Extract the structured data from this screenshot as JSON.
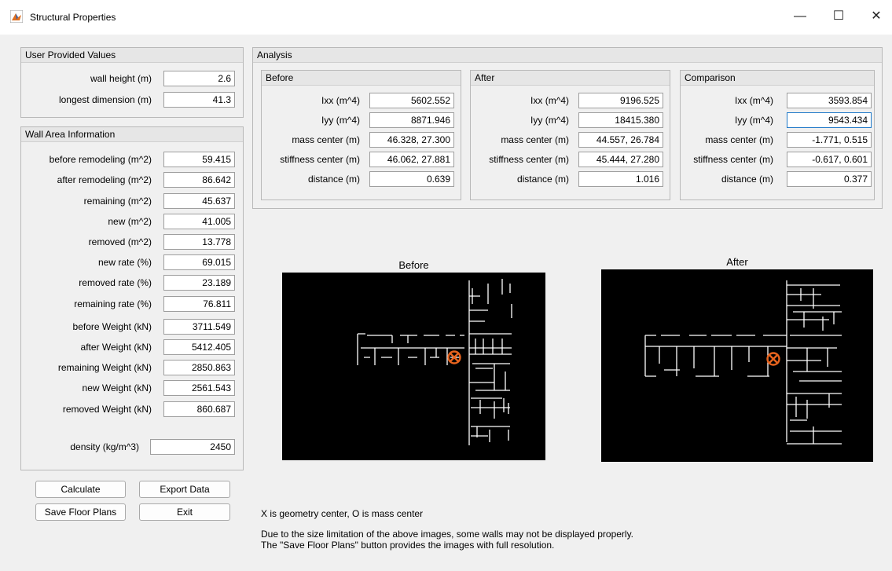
{
  "window": {
    "title": "Structural Properties",
    "minimize": "—",
    "maximize": "☐",
    "close": "✕"
  },
  "user_values": {
    "title": "User Provided Values",
    "rows": [
      {
        "label": "wall height (m)",
        "value": "2.6"
      },
      {
        "label": "longest dimension (m)",
        "value": "41.3"
      }
    ]
  },
  "wall_area": {
    "title": "Wall Area Information",
    "rows": [
      {
        "label": "before remodeling (m^2)",
        "value": "59.415"
      },
      {
        "label": "after remodeling (m^2)",
        "value": "86.642"
      },
      {
        "label": "remaining (m^2)",
        "value": "45.637"
      },
      {
        "label": "new (m^2)",
        "value": "41.005"
      },
      {
        "label": "removed (m^2)",
        "value": "13.778"
      },
      {
        "label": "new rate (%)",
        "value": "69.015"
      },
      {
        "label": "removed rate (%)",
        "value": "23.189"
      },
      {
        "label": "remaining rate (%)",
        "value": "76.811"
      },
      {
        "label": "before Weight (kN)",
        "value": "3711.549"
      },
      {
        "label": "after Weight (kN)",
        "value": "5412.405"
      },
      {
        "label": "remaining Weight (kN)",
        "value": "2850.863"
      },
      {
        "label": "new Weight (kN)",
        "value": "2561.543"
      },
      {
        "label": "removed Weight (kN)",
        "value": "860.687"
      }
    ],
    "density_label": "density (kg/m^3)",
    "density_value": "2450"
  },
  "buttons": {
    "calculate": "Calculate",
    "export": "Export Data",
    "save_plans": "Save Floor Plans",
    "exit": "Exit"
  },
  "analysis": {
    "title": "Analysis",
    "groups": [
      {
        "title": "Before",
        "rows": [
          {
            "label": "Ixx (m^4)",
            "value": "5602.552"
          },
          {
            "label": "Iyy (m^4)",
            "value": "8871.946"
          },
          {
            "label": "mass center (m)",
            "value": "46.328, 27.300"
          },
          {
            "label": "stiffness center (m)",
            "value": "46.062, 27.881"
          },
          {
            "label": "distance (m)",
            "value": "0.639"
          }
        ]
      },
      {
        "title": "After",
        "rows": [
          {
            "label": "Ixx (m^4)",
            "value": "9196.525"
          },
          {
            "label": "Iyy (m^4)",
            "value": "18415.380"
          },
          {
            "label": "mass center (m)",
            "value": "44.557, 26.784"
          },
          {
            "label": "stiffness center (m)",
            "value": "45.444, 27.280"
          },
          {
            "label": "distance (m)",
            "value": "1.016"
          }
        ]
      },
      {
        "title": "Comparison",
        "rows": [
          {
            "label": "Ixx (m^4)",
            "value": "3593.854"
          },
          {
            "label": "Iyy (m^4)",
            "value": "9543.434"
          },
          {
            "label": "mass center (m)",
            "value": "-1.771, 0.515"
          },
          {
            "label": "stiffness center (m)",
            "value": "-0.617, 0.601"
          },
          {
            "label": "distance (m)",
            "value": "0.377"
          }
        ]
      }
    ]
  },
  "plots": {
    "before_title": "Before",
    "after_title": "After",
    "wall_color": "#ffffff",
    "marker_color": "#e8641e"
  },
  "notes": {
    "legend": "X is geometry center, O is mass center",
    "line1": "Due to the size limitation of the above images, some walls may not be displayed properly.",
    "line2": "The \"Save Floor Plans\" button provides the images with full resolution."
  }
}
